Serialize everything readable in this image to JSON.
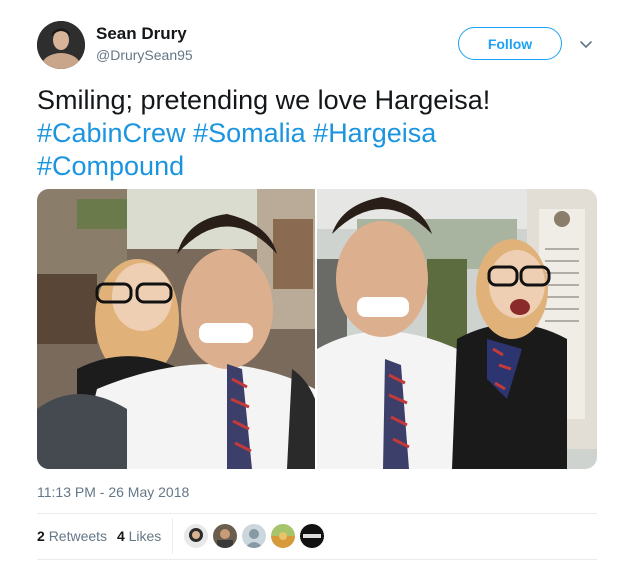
{
  "author": {
    "name": "Sean Drury",
    "handle": "@DrurySean95"
  },
  "actions": {
    "follow_label": "Follow"
  },
  "tweet": {
    "text_lines": [
      [
        {
          "text": "Smiling; pretending we love Hargeisa!",
          "hashtag": false
        }
      ],
      [
        {
          "text": "#CabinCrew",
          "hashtag": true
        },
        {
          "text": " ",
          "hashtag": false
        },
        {
          "text": "#Somalia",
          "hashtag": true
        },
        {
          "text": " ",
          "hashtag": false
        },
        {
          "text": "#Hargeisa",
          "hashtag": true
        }
      ],
      [
        {
          "text": "#Compound",
          "hashtag": true
        }
      ]
    ],
    "timestamp": "11:13 PM - 26 May 2018"
  },
  "stats": {
    "retweets_count": "2",
    "retweets_label": "Retweets",
    "likes_count": "4",
    "likes_label": "Likes"
  },
  "liker_avatars": [
    "liker-avatar-1",
    "liker-avatar-2",
    "liker-avatar-3",
    "liker-avatar-4",
    "liker-avatar-5"
  ],
  "colors": {
    "accent": "#1da1f2",
    "hashtag": "#1b95e0",
    "secondary_text": "#657786",
    "primary_text": "#14171a",
    "divider": "#e6ecf0"
  }
}
